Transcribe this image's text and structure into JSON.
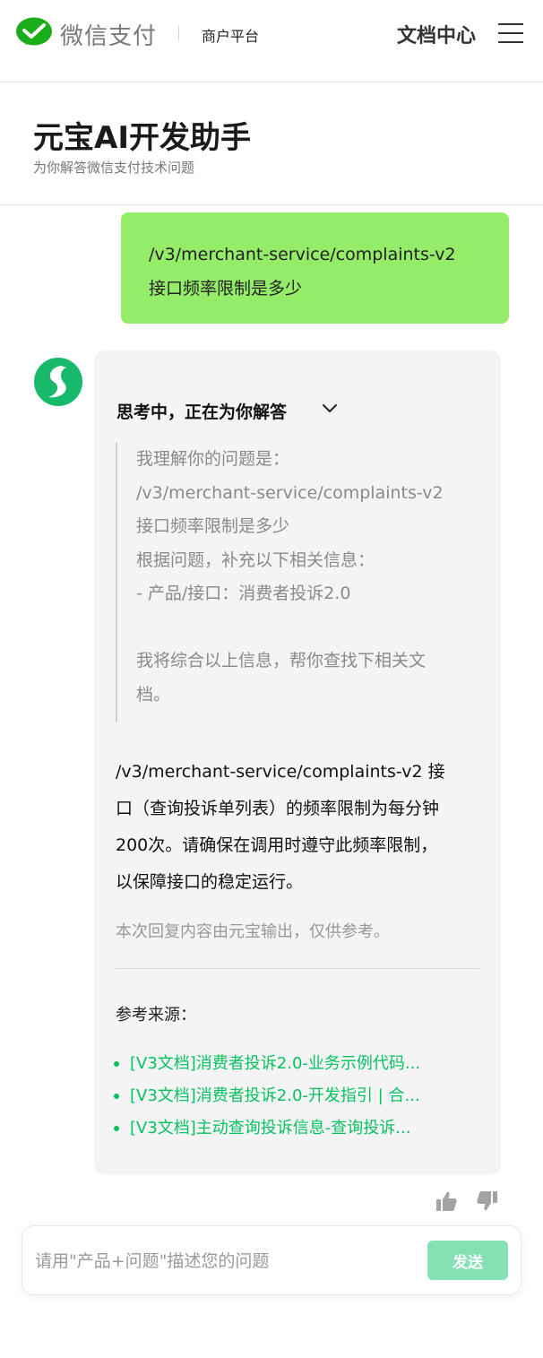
{
  "topbar": {
    "brand": "微信支付",
    "merchant_label": "商户平台",
    "doc_center": "文档中心"
  },
  "header": {
    "title": "元宝AI开发助手",
    "subtitle": "为你解答微信支付技术问题"
  },
  "user_message": {
    "lines": [
      "/v3/merchant-service/complaints-v2",
      "接口频率限制是多少"
    ]
  },
  "assistant": {
    "thinking_label": "思考中，正在为你解答",
    "thinking_lines": [
      "我理解你的问题是：",
      "/v3/merchant-service/complaints-v2",
      "接口频率限制是多少",
      "根据问题，补充以下相关信息：",
      "- 产品/接口：消费者投诉2.0",
      "",
      "我将综合以上信息，帮你查找下相关文",
      "档。"
    ],
    "answer_lines": [
      "/v3/merchant-service/complaints-v2 接",
      "口（查询投诉单列表）的频率限制为每分钟",
      "200次。请确保在调用时遵守此频率限制，",
      "以保障接口的稳定运行。"
    ],
    "disclaimer": "本次回复内容由元宝输出，仅供参考。",
    "references_title": "参考来源：",
    "references": [
      "[V3文档]消费者投诉2.0-业务示例代码...",
      "[V3文档]消费者投诉2.0-开发指引 | 合...",
      "[V3文档]主动查询投诉信息-查询投诉..."
    ]
  },
  "input": {
    "placeholder": "请用\"产品+问题\"描述您的问题",
    "value": "",
    "send_label": "发送"
  },
  "colors": {
    "wechat_green": "#07c160",
    "user_bubble": "#95ec69",
    "send_disabled": "#85e0b3",
    "card_bg": "#f4f4f4"
  }
}
